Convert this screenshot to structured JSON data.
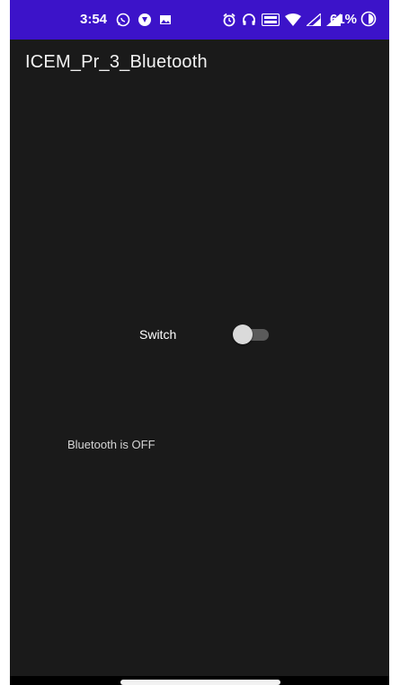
{
  "status_bar": {
    "time": "3:54",
    "battery": "61%",
    "left_icons": [
      "whatsapp-icon",
      "phone-call-icon",
      "gallery-icon"
    ],
    "right_icons": [
      "alarm-icon",
      "headset-icon",
      "volte-icon",
      "wifi-icon",
      "signal-icon",
      "signal-icon"
    ]
  },
  "app": {
    "title": "ICEM_Pr_3_Bluetooth"
  },
  "switch": {
    "label": "Switch",
    "checked": false
  },
  "bluetooth": {
    "status_text": "Bluetooth is OFF"
  },
  "colors": {
    "status_bar": "#3c13c9",
    "background": "#1a1a1a"
  }
}
